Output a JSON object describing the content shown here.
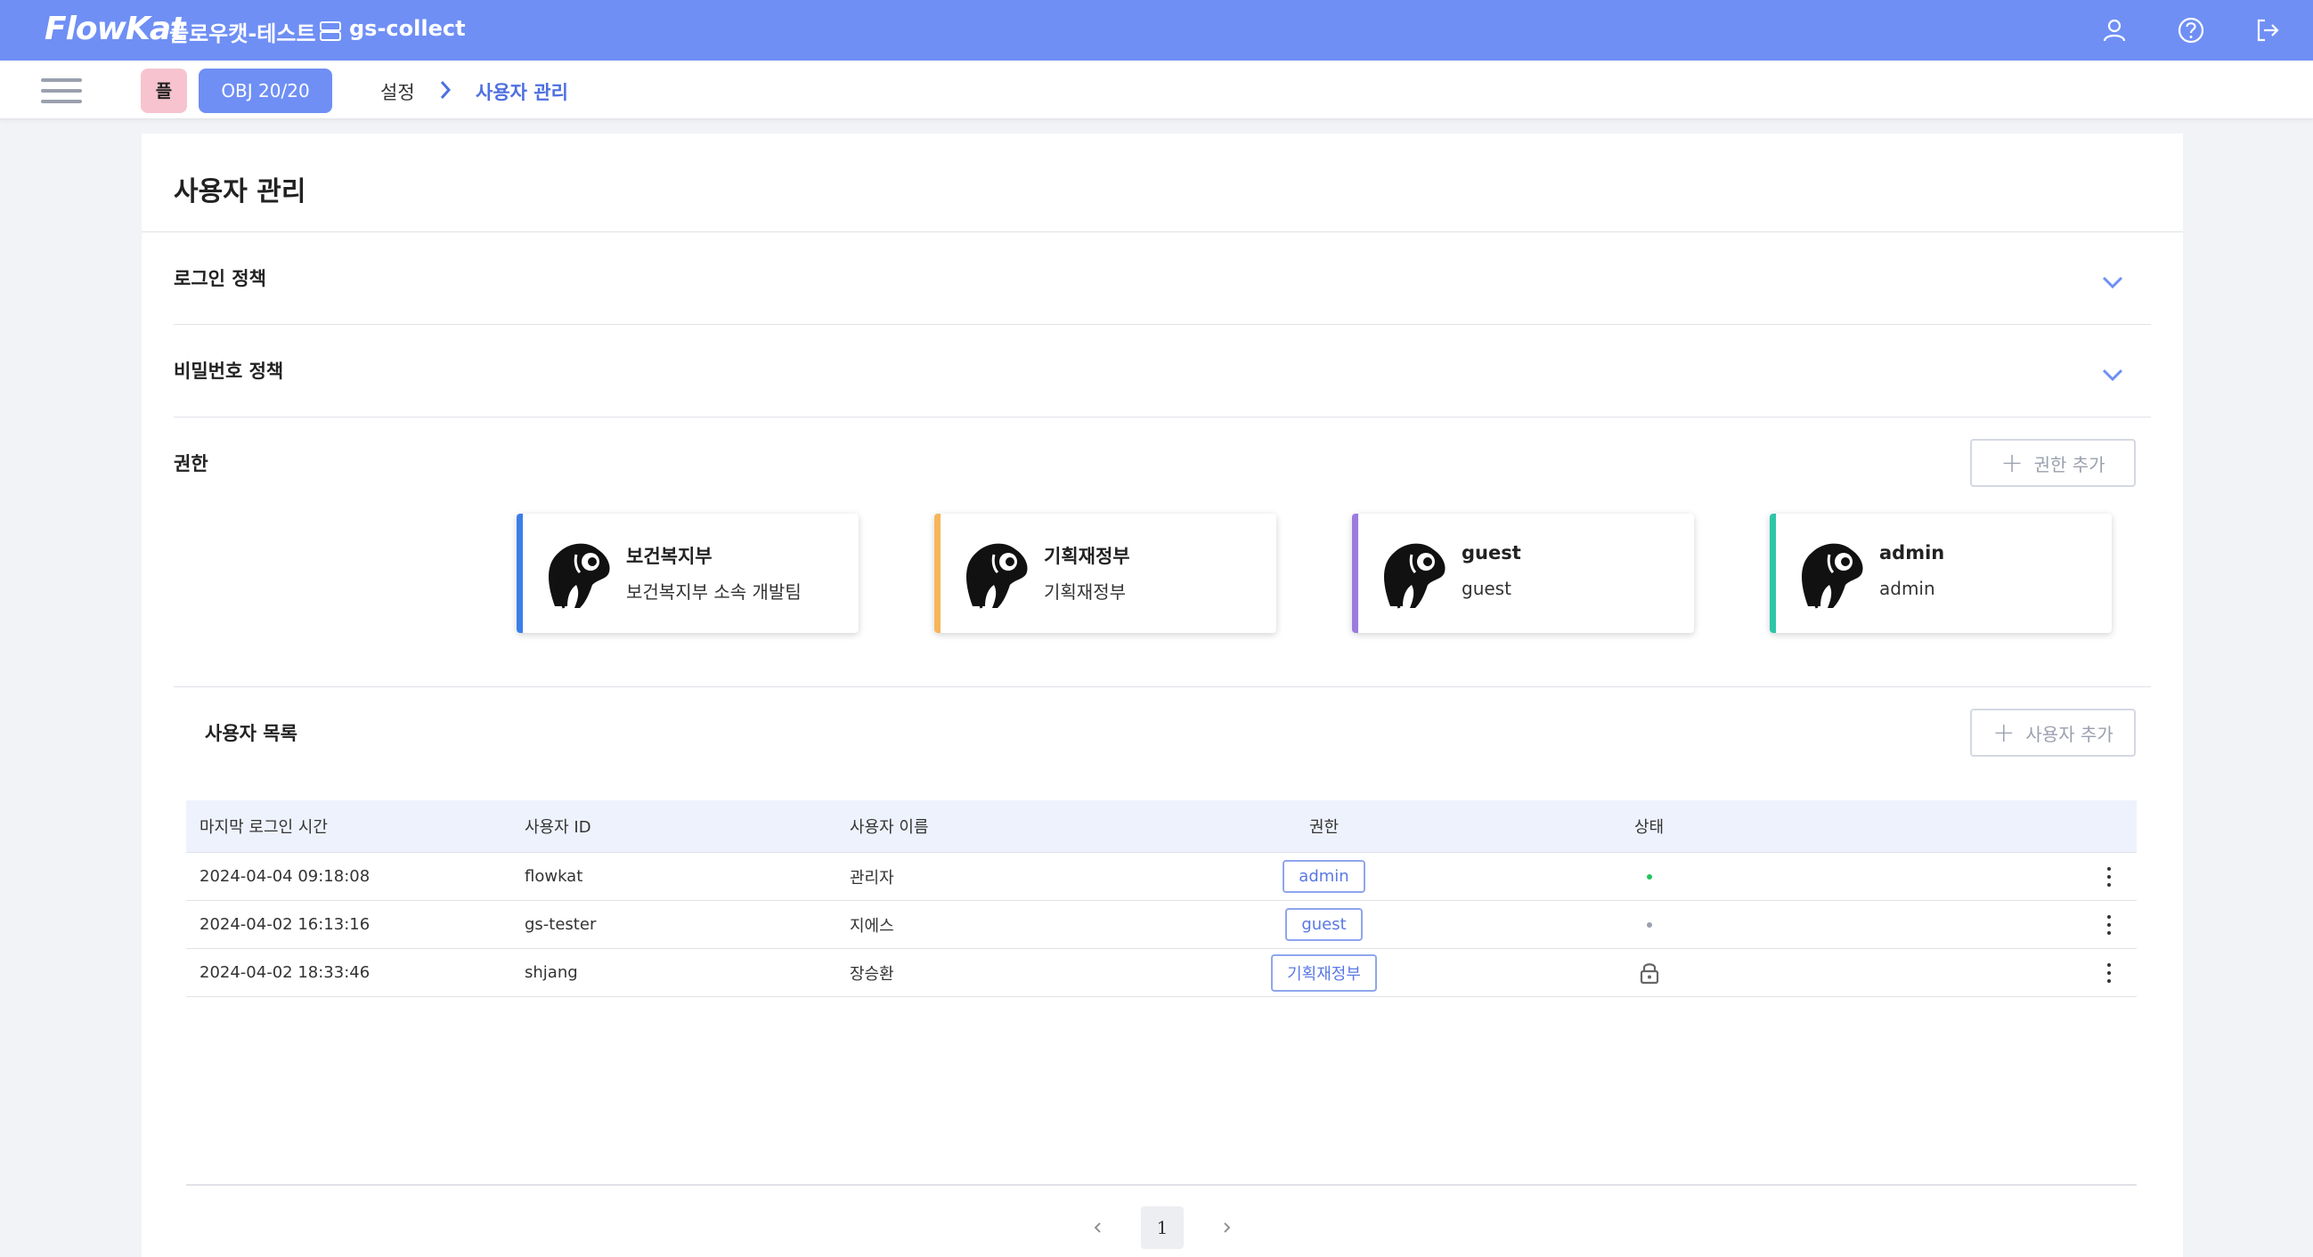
{
  "header": {
    "logo": "FlowKat",
    "project": "플로우캣-테스트",
    "collector": "gs-collect",
    "icons": [
      "user-icon",
      "help-icon",
      "logout-icon"
    ]
  },
  "subbar": {
    "badge": "플",
    "obj_button": "OBJ 20/20",
    "breadcrumb": [
      "설정",
      "사용자 관리"
    ]
  },
  "page": {
    "title": "사용자 관리",
    "sections": {
      "login_policy": "로그인 정책",
      "password_policy": "비밀번호 정책",
      "permissions": "권한",
      "add_permission": "권한 추가",
      "user_list": "사용자 목록",
      "add_user": "사용자 추가"
    },
    "roles": [
      {
        "name": "보건복지부",
        "desc": "보건복지부 소속 개발팀",
        "color": "#3b7ee9"
      },
      {
        "name": "기획재정부",
        "desc": "기획재정부",
        "color": "#f7b55a"
      },
      {
        "name": "guest",
        "desc": "guest",
        "color": "#9b7be0"
      },
      {
        "name": "admin",
        "desc": "admin",
        "color": "#2ec6a8"
      }
    ],
    "table": {
      "headers": [
        "마지막 로그인 시간",
        "사용자 ID",
        "사용자 이름",
        "권한",
        "상태"
      ],
      "rows": [
        {
          "last_login": "2024-04-04 09:18:08",
          "id": "flowkat",
          "name": "관리자",
          "role": "admin",
          "status": "active"
        },
        {
          "last_login": "2024-04-02 16:13:16",
          "id": "gs-tester",
          "name": "지에스",
          "role": "guest",
          "status": "inactive"
        },
        {
          "last_login": "2024-04-02 18:33:46",
          "id": "shjang",
          "name": "장승환",
          "role": "기획재정부",
          "status": "locked"
        }
      ]
    },
    "pagination": {
      "current": "1"
    }
  },
  "colors": {
    "header_bg": "#6f8ff5",
    "accent": "#4e6fe0",
    "active_status": "#22c55e",
    "inactive_status": "#9aa0ae"
  }
}
